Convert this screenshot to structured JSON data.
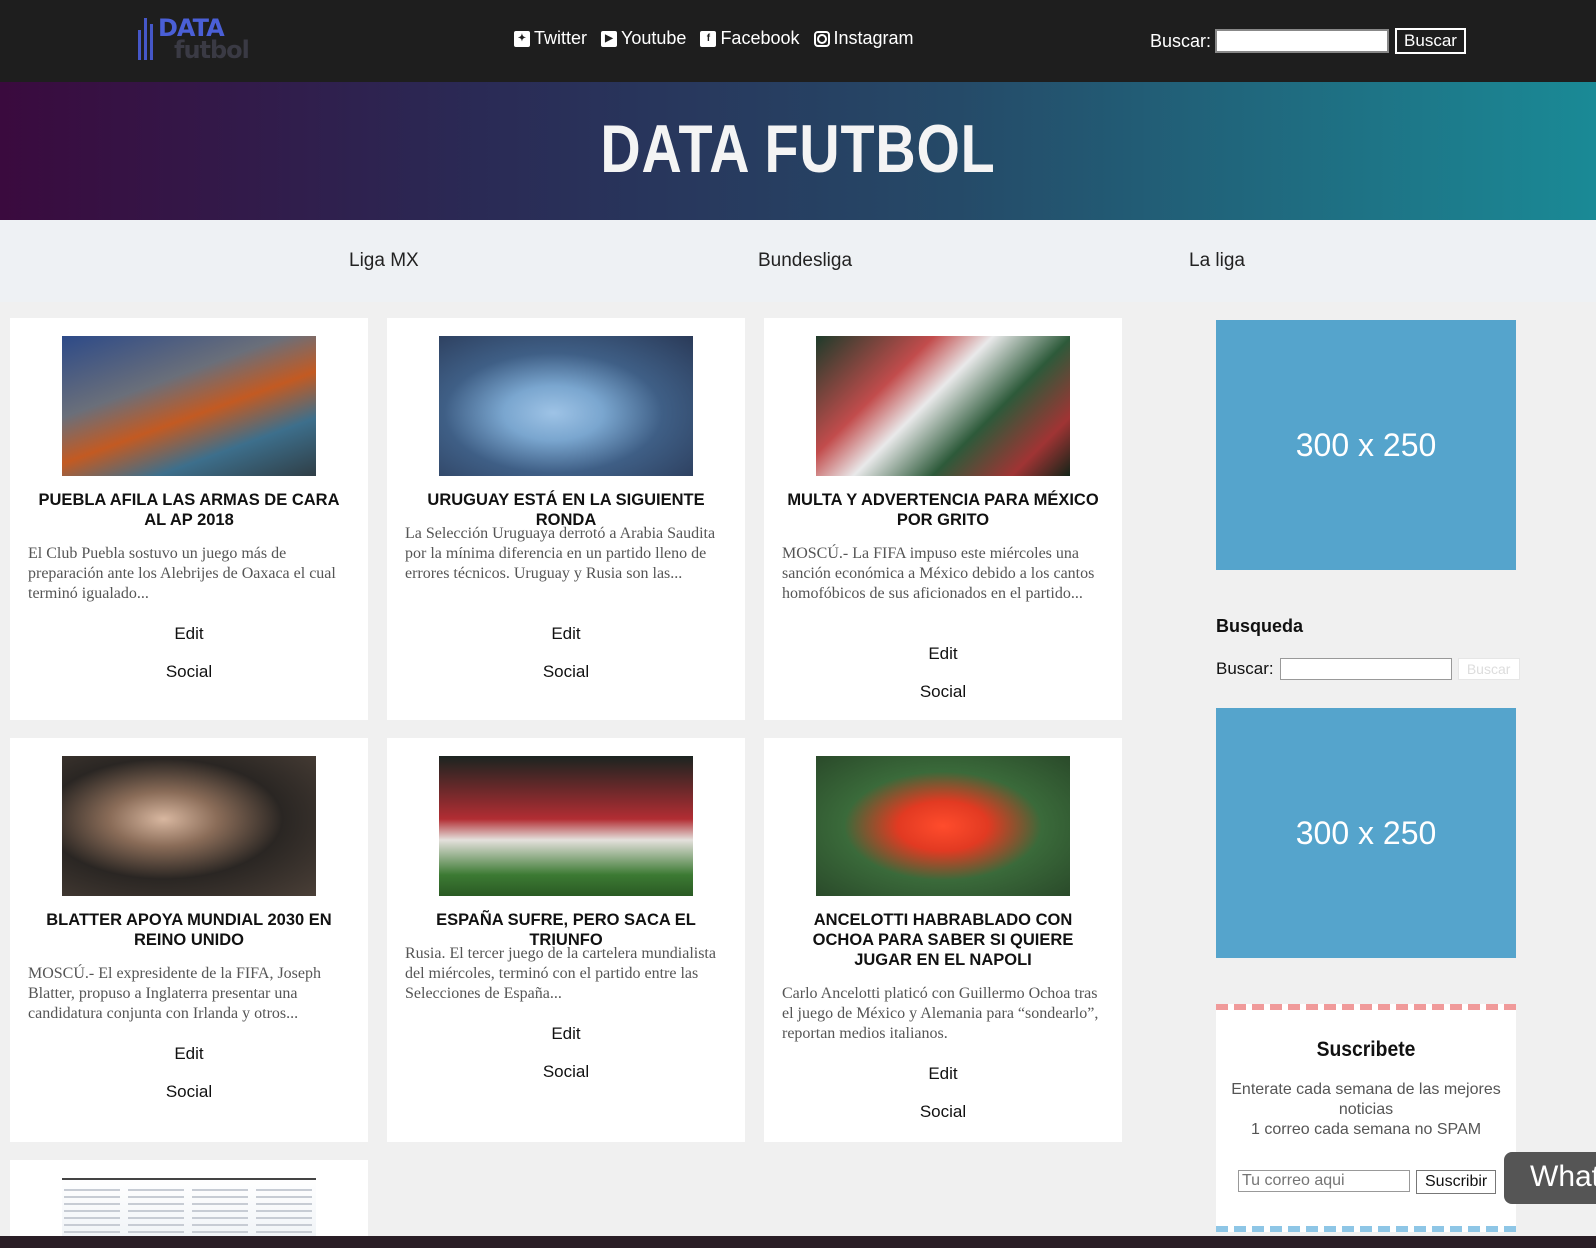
{
  "header": {
    "logo_line1": "DATA",
    "logo_line2": "futbol",
    "social": [
      {
        "label": "Twitter",
        "icon": "twitter-icon"
      },
      {
        "label": "Youtube",
        "icon": "youtube-icon"
      },
      {
        "label": "Facebook",
        "icon": "facebook-icon"
      },
      {
        "label": "Instagram",
        "icon": "instagram-icon"
      }
    ],
    "search_label": "Buscar:",
    "search_button": "Buscar"
  },
  "hero": {
    "title": "DATA FUTBOL"
  },
  "nav": {
    "items": [
      "Liga MX",
      "Bundesliga",
      "La liga"
    ]
  },
  "articles": [
    {
      "title": "PUEBLA AFILA LAS ARMAS DE CARA AL AP 2018",
      "excerpt": "El Club Puebla sostuvo un juego más de preparación ante los Alebrijes de Oaxaca el cual terminó igualado...",
      "edit": "Edit",
      "social": "Social"
    },
    {
      "title": "URUGUAY ESTÁ EN LA SIGUIENTE RONDA",
      "excerpt": "La Selección Uruguaya derrotó a Arabia Saudita por la mínima diferencia en un partido lleno de errores técnicos. Uruguay y Rusia son las...",
      "edit": "Edit",
      "social": "Social"
    },
    {
      "title": "MULTA Y ADVERTENCIA PARA MÉXICO POR GRITO",
      "excerpt": "MOSCÚ.- La FIFA impuso este miércoles una sanción económica a México debido a los cantos homofóbicos de sus aficionados en el partido...",
      "edit": "Edit",
      "social": "Social"
    },
    {
      "title": "BLATTER APOYA MUNDIAL 2030 EN REINO UNIDO",
      "excerpt": "MOSCÚ.- El expresidente de la FIFA, Joseph Blatter, propuso a Inglaterra presentar una candidatura conjunta con Irlanda y otros...",
      "edit": "Edit",
      "social": "Social"
    },
    {
      "title": "ESPAÑA SUFRE, PERO SACA EL TRIUNFO",
      "excerpt": "Rusia. El tercer juego de la cartelera mundialista del miércoles, terminó con el partido entre las Selecciones de España...",
      "edit": "Edit",
      "social": "Social"
    },
    {
      "title": "ANCELOTTI HABRABLADO CON OCHOA PARA SABER SI QUIERE JUGAR EN EL NAPOLI",
      "excerpt": "Carlo Ancelotti platicó con Guillermo Ochoa tras el juego de México y Alemania para “sondearlo”, reportan medios italianos.",
      "edit": "Edit",
      "social": "Social"
    }
  ],
  "sidebar": {
    "ad1": "300 x 250",
    "ad2": "300 x 250",
    "search_title": "Busqueda",
    "search_label": "Buscar:",
    "search_button": "Buscar",
    "subscribe": {
      "title": "Suscribete",
      "text1": "Enterate cada semana de las mejores noticias",
      "text2": "1 correo cada semana no SPAM",
      "placeholder": "Tu correo aqui",
      "button": "Suscribir"
    }
  },
  "floating": {
    "whatsapp": "What"
  }
}
